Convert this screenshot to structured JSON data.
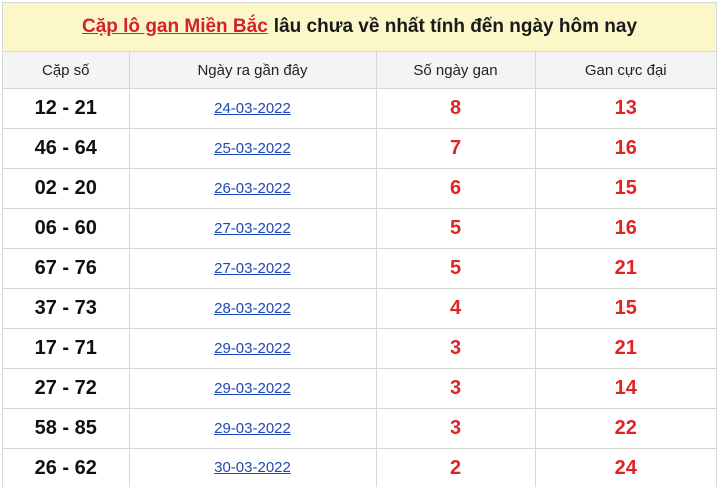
{
  "title": {
    "link_text": "Cặp lô gan Miền Bắc",
    "rest_text": "lâu chưa về nhất tính đến ngày hôm nay"
  },
  "columns": [
    "Cặp số",
    "Ngày ra gần đây",
    "Số ngày gan",
    "Gan cực đại"
  ],
  "rows": [
    {
      "pair": "12 - 21",
      "date": "24-03-2022",
      "days": "8",
      "max": "13"
    },
    {
      "pair": "46 - 64",
      "date": "25-03-2022",
      "days": "7",
      "max": "16"
    },
    {
      "pair": "02 - 20",
      "date": "26-03-2022",
      "days": "6",
      "max": "15"
    },
    {
      "pair": "06 - 60",
      "date": "27-03-2022",
      "days": "5",
      "max": "16"
    },
    {
      "pair": "67 - 76",
      "date": "27-03-2022",
      "days": "5",
      "max": "21"
    },
    {
      "pair": "37 - 73",
      "date": "28-03-2022",
      "days": "4",
      "max": "15"
    },
    {
      "pair": "17 - 71",
      "date": "29-03-2022",
      "days": "3",
      "max": "21"
    },
    {
      "pair": "27 - 72",
      "date": "29-03-2022",
      "days": "3",
      "max": "14"
    },
    {
      "pair": "58 - 85",
      "date": "29-03-2022",
      "days": "3",
      "max": "22"
    },
    {
      "pair": "26 - 62",
      "date": "30-03-2022",
      "days": "2",
      "max": "24"
    }
  ],
  "colors": {
    "title_background": "#fbf7c9",
    "title_link": "#d4212d",
    "date_link": "#1f47b8",
    "number_red": "#e02424"
  }
}
